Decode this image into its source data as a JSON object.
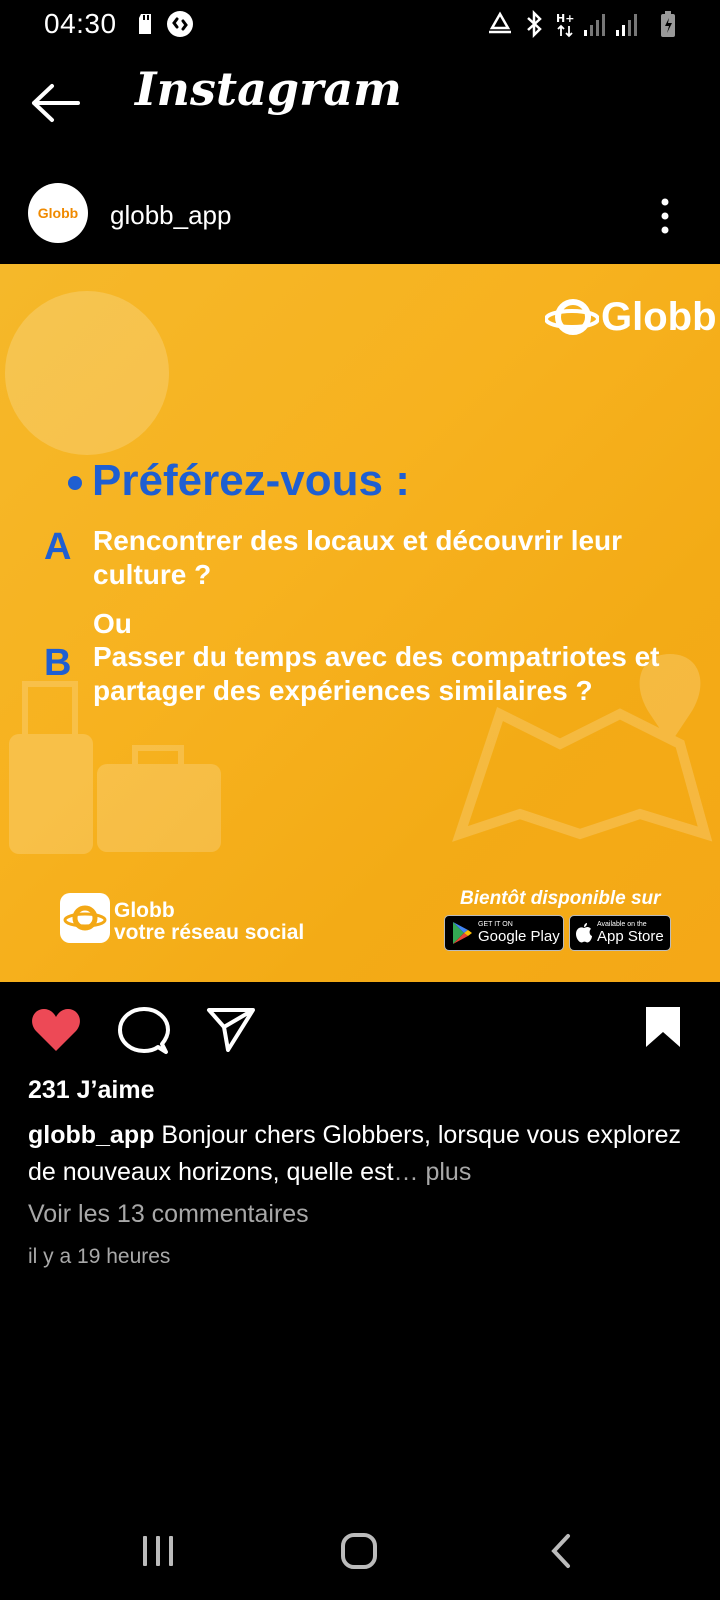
{
  "status_bar": {
    "time": "04:30",
    "icons": [
      "sd-card-icon",
      "shazam-icon",
      "recycle-icon",
      "bluetooth-icon",
      "network-h-plus-icon",
      "signal-icon",
      "signal-icon",
      "battery-icon"
    ]
  },
  "header": {
    "title": "Instagram",
    "back_icon": "back-arrow-icon"
  },
  "post": {
    "username": "globb_app",
    "avatar_text": "Globb",
    "more_icon": "more-vertical-icon",
    "image": {
      "brand": "Globb",
      "question": "Préférez-vous :",
      "option_a_letter": "A",
      "option_a": "Rencontrer des locaux et découvrir leur culture ?",
      "or": "Ou",
      "option_b_letter": "B",
      "option_b": "Passer du temps avec des compatriotes et partager des expériences similaires ?",
      "footer_title": "Globb",
      "footer_subtitle": "votre réseau social",
      "coming_soon": "Bientôt disponible sur",
      "google_small": "GET IT ON",
      "google_big": "Google Play",
      "apple_small": "Available on the",
      "apple_big": "App Store"
    },
    "actions": {
      "like_icon": "heart-filled-icon",
      "comment_icon": "comment-icon",
      "share_icon": "send-icon",
      "save_icon": "bookmark-filled-icon",
      "like_color": "#ed4956"
    },
    "likes": "231 J’aime",
    "caption_user": "globb_app",
    "caption_text": " Bonjour chers Globbers, lorsque vous explorez de nouveaux horizons, quelle est",
    "caption_ellipsis": "…",
    "caption_more": " plus",
    "comments_link": "Voir les 13 commentaires",
    "timestamp": "il y a 19 heures"
  },
  "nav_bar": {
    "icons": [
      "recent-apps-icon",
      "home-icon",
      "back-icon"
    ]
  },
  "colors": {
    "background": "#000000",
    "post_orange": "#f5b21f",
    "question_blue": "#1f5fd1",
    "muted_text": "#a8a8a8"
  }
}
